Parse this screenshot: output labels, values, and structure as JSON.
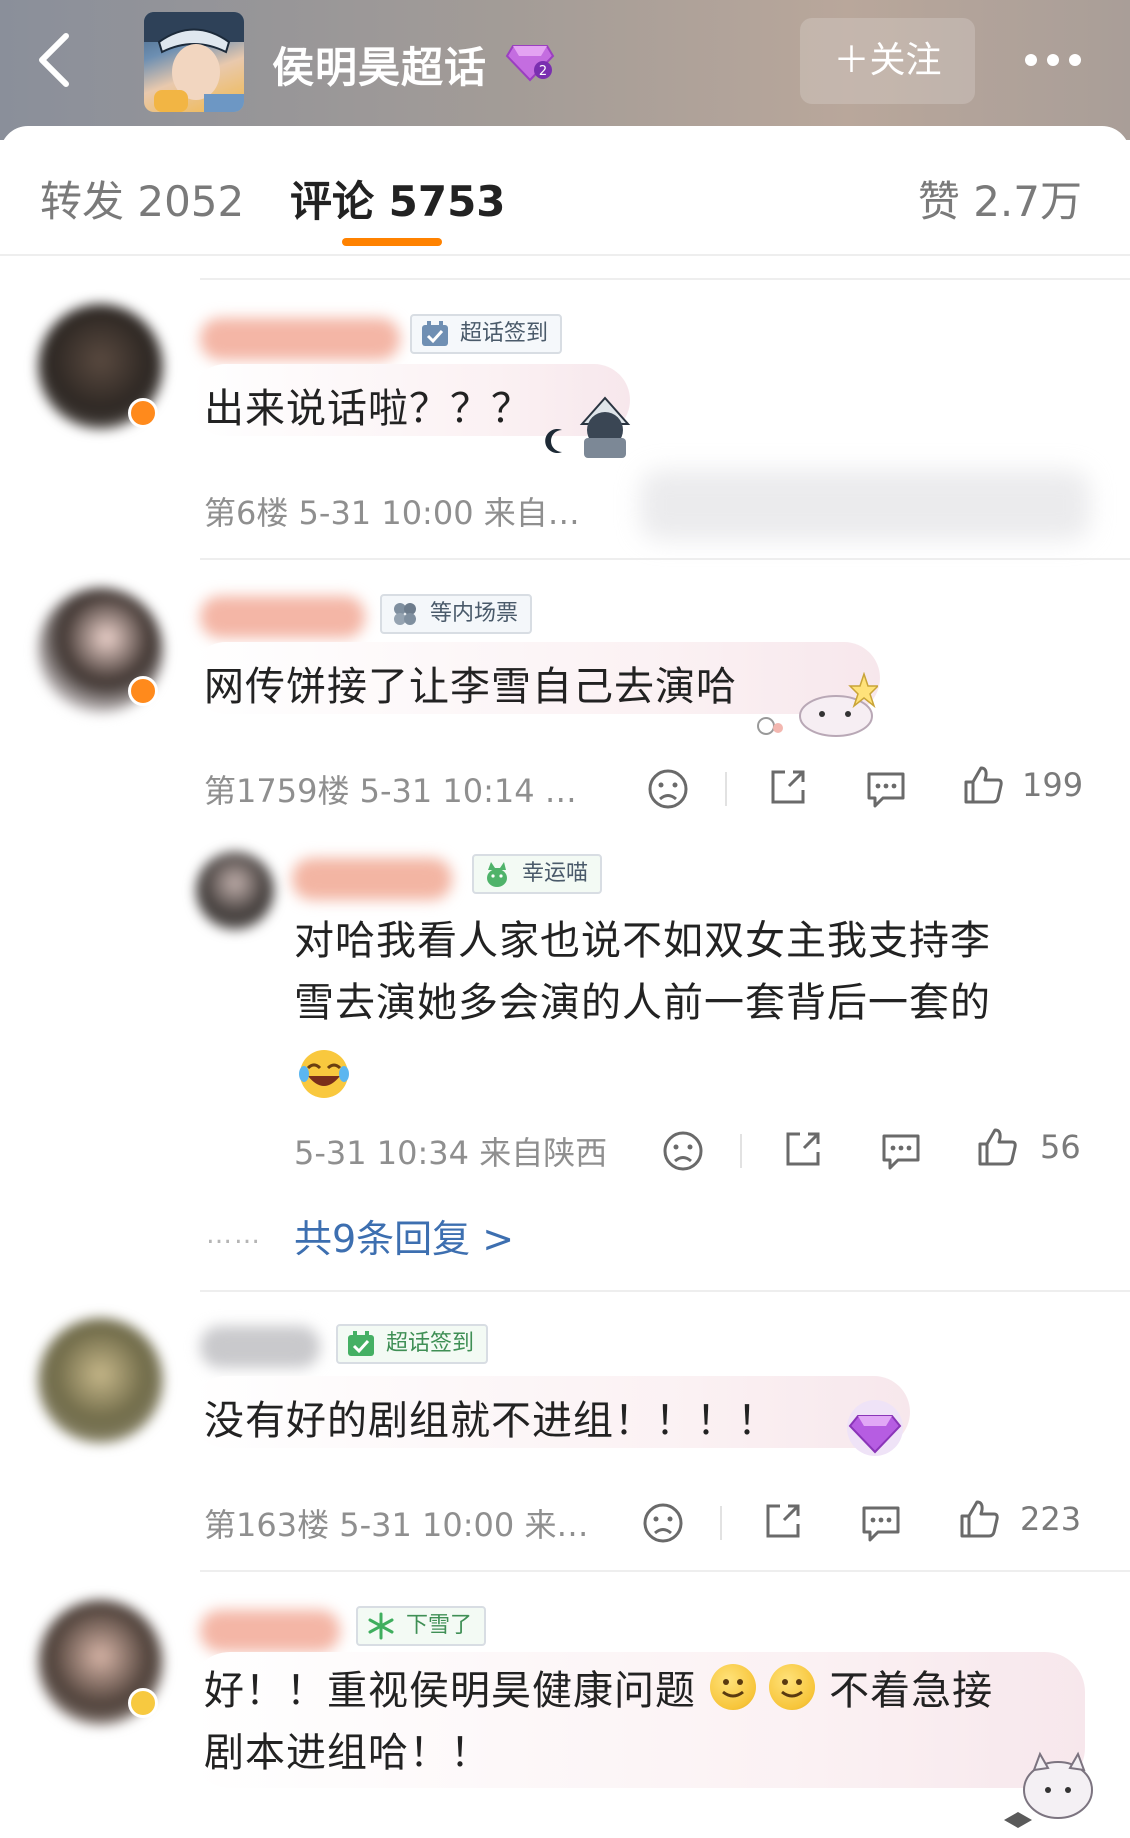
{
  "header": {
    "title": "侯明昊超话",
    "follow_label": "＋关注",
    "back_icon": "chevron-left-icon",
    "more_icon": "more-dots-icon",
    "level_icon": "diamond-level-icon",
    "level_number": "2"
  },
  "tabs": {
    "repost": "转发 2052",
    "comment": "评论 5753",
    "like": "赞 2.7万",
    "active": "comment",
    "accent": "#ff8200"
  },
  "comments": [
    {
      "tag": "超话签到",
      "tag_icon": "checkin-calendar-icon",
      "text": "出来说话啦？？？",
      "meta": "第6楼 5-31 10:00 来自…",
      "sticker": "anime-character-sticker",
      "moon_icon": "moon-icon"
    },
    {
      "tag": "等内场票",
      "tag_icon": "clover-icon",
      "text": "网传饼接了让李雪自己去演哈",
      "meta": "第1759楼 5-31 10:14 …",
      "likes": "199",
      "sticker": "cute-bunny-sticker"
    },
    {
      "tag": "超话签到",
      "tag_icon": "checkin-calendar-icon",
      "text": "没有好的剧组就不进组！！！！",
      "meta": "第163楼 5-31 10:00 来…",
      "likes": "223",
      "sticker": "purple-diamond-sticker"
    },
    {
      "tag": "下雪了",
      "tag_icon": "snowflake-icon",
      "text_line1_a": "好！！重视侯明昊健康问题",
      "text_line1_b": "不着急接",
      "text_line2": "剧本进组哈！！",
      "emoji_icon": "smile-emoji-icon",
      "sticker": "cat-bow-sticker"
    }
  ],
  "reply": {
    "tag": "幸运喵",
    "tag_icon": "lucky-cat-icon",
    "line1": "对哈我看人家也说不如双女主我支持李",
    "line2": "雪去演她多会演的人前一套背后一套的",
    "emoji_icon": "laugh-cry-emoji-icon",
    "meta": "5-31 10:34 来自陕西",
    "likes": "56"
  },
  "more_replies": {
    "leader": "……",
    "label": "共9条回复 >"
  },
  "action_icons": [
    "dislike-face-icon",
    "share-icon",
    "comment-icon",
    "thumbs-up-icon"
  ]
}
